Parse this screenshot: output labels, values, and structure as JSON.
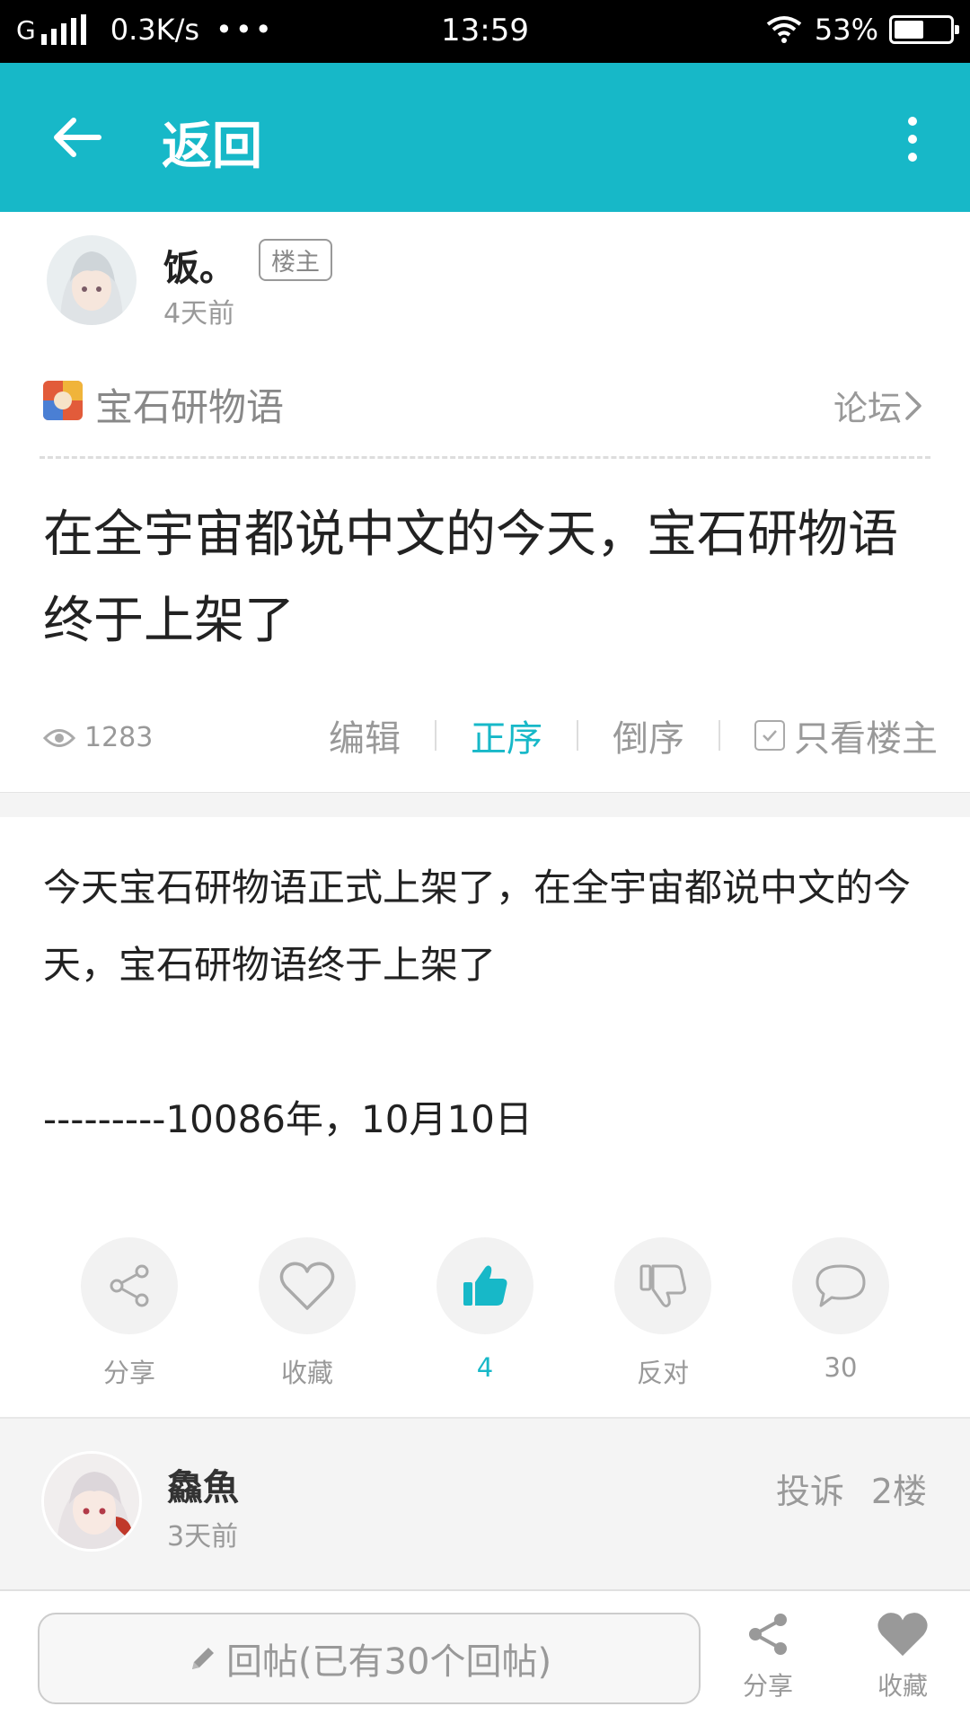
{
  "status_bar": {
    "network_type": "G",
    "speed": "0.3K/s",
    "dots": "•••",
    "time": "13:59",
    "battery": "53%",
    "battery_level": 0.53
  },
  "toolbar": {
    "back_icon": "arrow-left-icon",
    "title": "返回",
    "more_icon": "more-vertical-icon"
  },
  "author": {
    "name": "饭。",
    "badge": "楼主",
    "time": "4天前"
  },
  "forum": {
    "game_name": "宝石研物语",
    "link_label": "论坛",
    "link_icon": "chevron-right-icon"
  },
  "post": {
    "title": "在全宇宙都说中文的今天，宝石研物语终于上架了",
    "views": "1283",
    "body_line1": "今天宝石研物语正式上架了，在全宇宙都说中文的今天，宝石研物语终于上架了",
    "body_line2": "---------10086年，10月10日"
  },
  "sort": {
    "edit": "编辑",
    "asc": "正序",
    "desc": "倒序",
    "owner_only": "只看楼主"
  },
  "actions": {
    "share": "分享",
    "favorite": "收藏",
    "like_count": "4",
    "oppose": "反对",
    "comment_count": "30"
  },
  "reply": {
    "name": "鱻魚",
    "time": "3天前",
    "report": "投诉",
    "floor": "2楼"
  },
  "bottom_bar": {
    "reply_placeholder": "回帖(已有30个回帖)",
    "share": "分享",
    "favorite": "收藏"
  },
  "colors": {
    "accent": "#17b8c8",
    "muted": "#999999"
  }
}
